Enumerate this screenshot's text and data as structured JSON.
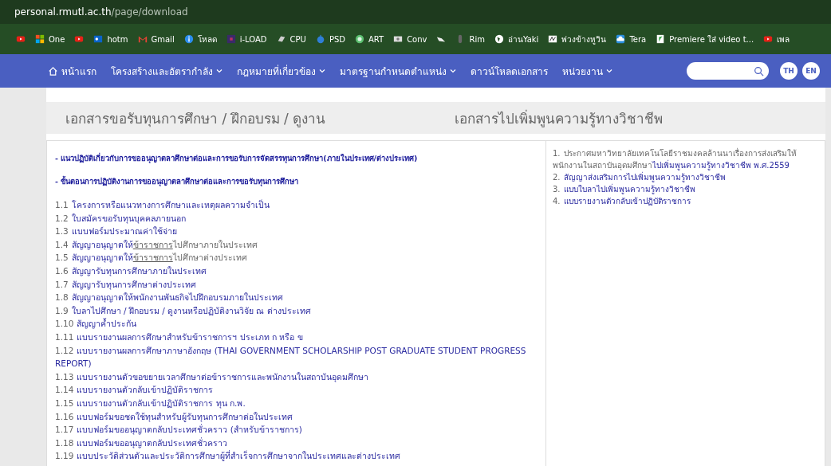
{
  "address_bar": {
    "host": "personal.rmutl.ac.th",
    "path": "/page/download"
  },
  "bookmarks": [
    {
      "kind": "youtube"
    },
    {
      "kind": "windows",
      "label": "One"
    },
    {
      "kind": "youtube"
    },
    {
      "kind": "outlook",
      "label": "hotm"
    },
    {
      "kind": "gmail",
      "label": "Gmail"
    },
    {
      "kind": "info",
      "label": "โหลด"
    },
    {
      "kind": "square",
      "label": "i-LOAD"
    },
    {
      "kind": "chip",
      "label": "CPU"
    },
    {
      "kind": "robot",
      "label": "PSD"
    },
    {
      "kind": "circle",
      "label": "ART"
    },
    {
      "kind": "screen",
      "label": "Conv"
    },
    {
      "kind": "bird"
    },
    {
      "kind": "mouse",
      "label": "Rim"
    },
    {
      "kind": "globe",
      "label": "อ่านYaki"
    },
    {
      "kind": "sign",
      "label": "พ่วงข้างหูวิน"
    },
    {
      "kind": "cloud",
      "label": "Tera"
    },
    {
      "kind": "leaf",
      "label": "Premiere ใส่ video t..."
    },
    {
      "kind": "youtube",
      "label": "เพล"
    }
  ],
  "nav": {
    "items": [
      {
        "label": "หน้าแรก",
        "kind": "home"
      },
      {
        "label": "โครงสร้างและอัตรากำลัง",
        "kind": "dropdown"
      },
      {
        "label": "กฎหมายที่เกี่ยวข้อง",
        "kind": "dropdown"
      },
      {
        "label": "มาตรฐานกำหนดตำแหน่ง",
        "kind": "dropdown"
      },
      {
        "label": "ดาวน์โหลดเอกสาร",
        "kind": "plain"
      },
      {
        "label": "หน่วยงาน",
        "kind": "dropdown"
      }
    ],
    "languages": [
      "TH",
      "EN"
    ]
  },
  "left_title": "เอกสารขอรับทุนการศึกษา / ฝึกอบรม / ดูงาน",
  "right_title": "เอกสารไปเพิ่มพูนความรู้ทางวิชาชีพ",
  "left_headings": [
    "- แนวปฏิบัติเกี่ยวกับการขออนุญาตลาศึกษาต่อและการขอรับการจัดสรรทุนการศึกษา(ภายในประเทศ/ต่างประเทศ)",
    "- ขั้นตอนการปฏิบัติงานการขออนุญาตลาศึกษาต่อและการขอรับทุนการศึกษา"
  ],
  "left_items": [
    {
      "number": "1.1",
      "text": "โครงการหรือแนวทางการศึกษาและเหตุผลความจำเป็น"
    },
    {
      "number": "1.2",
      "text": "ใบสมัครขอรับทุนบุคคลภายนอก"
    },
    {
      "number": "1.3",
      "text": "แบบฟอร์มประมาณค่าใช้จ่าย"
    },
    {
      "number": "1.4",
      "text": "สัญญาอนุญาตให้",
      "link": "ข้าราชการ",
      "rest": "ไปศึกษาภายในประเทศ"
    },
    {
      "number": "1.5",
      "text": "สัญญาอนุญาตให้",
      "link": "ข้าราชการ",
      "rest": "ไปศึกษาต่างประเทศ"
    },
    {
      "number": "1.6",
      "text": "สัญญารับทุนการศึกษาภายในประเทศ"
    },
    {
      "number": "1.7",
      "text": "สัญญารับทุนการศึกษาต่างประเทศ"
    },
    {
      "number": "1.8",
      "text": "สัญญาอนุญาตให้พนักงานพันธกิจไปฝึกอบรมภายในประเทศ"
    },
    {
      "number": "1.9",
      "text": "ใบลาไปศึกษา / ฝึกอบรม / ดูงานหรือปฏิบัติงานวิจัย ณ ต่างประเทศ"
    },
    {
      "number": "1.10",
      "text": "สัญญาค้ำประกัน"
    },
    {
      "number": "1.11",
      "text": "แบบรายงานผลการศึกษาสำหรับข้าราชการฯ ประเภท ก หรือ ข"
    },
    {
      "number": "1.12",
      "text": "แบบรายงานผลการศึกษาภาษาอังกฤษ (THAI GOVERNMENT SCHOLARSHIP POST GRADUATE STUDENT PROGRESS REPORT)"
    },
    {
      "number": "1.13",
      "text": "แบบรายงานตัวขอขยายเวลาศึกษาต่อข้าราชการและพนักงานในสถาบันอุดมศึกษา"
    },
    {
      "number": "1.14",
      "text": "แบบรายงานตัวกลับเข้าปฏิบัติราชการ"
    },
    {
      "number": "1.15",
      "text": "แบบรายงานตัวกลับเข้าปฏิบัติราชการ ทุน ก.พ."
    },
    {
      "number": "1.16",
      "text": "แบบฟอร์มขอชดใช้ทุนสำหรับผู้รับทุนการศึกษาต่อในประเทศ"
    },
    {
      "number": "1.17",
      "text": "แบบฟอร์มขออนุญาตกลับประเทศชั่วคราว (สำหรับข้าราชการ)"
    },
    {
      "number": "1.18",
      "text": "แบบฟอร์มขออนุญาตกลับประเทศชั่วคราว"
    },
    {
      "number": "1.19",
      "text": "แบบประวัติส่วนตัวและประวัติการศึกษาผู้ที่สำเร็จการศึกษาจากในประเทศและต่างประเทศ"
    }
  ],
  "right_items": [
    {
      "number": "1.",
      "text": "ประกาศมหาวิทยาลัยเทคโนโลยีราชมงคลล้านนาเรื่องการส่งเสริมให้พนักงานในสถาบันอุดมศึกษา",
      "link": "ไปเพิ่มพูนความรู้ทางวิชาชีพ พ.ศ.2559"
    },
    {
      "number": "2.",
      "link": "สัญญาส่งเสริมการไปเพิ่มพูนความรู้ทางวิชาชีพ"
    },
    {
      "number": "3.",
      "link": "แบบใบลาไปเพิ่มพูนความรู้ทางวิชาชีพ"
    },
    {
      "number": "4.",
      "link": "แบบรายงานตัวกลับเข้าปฏิบัติราชการ"
    }
  ]
}
